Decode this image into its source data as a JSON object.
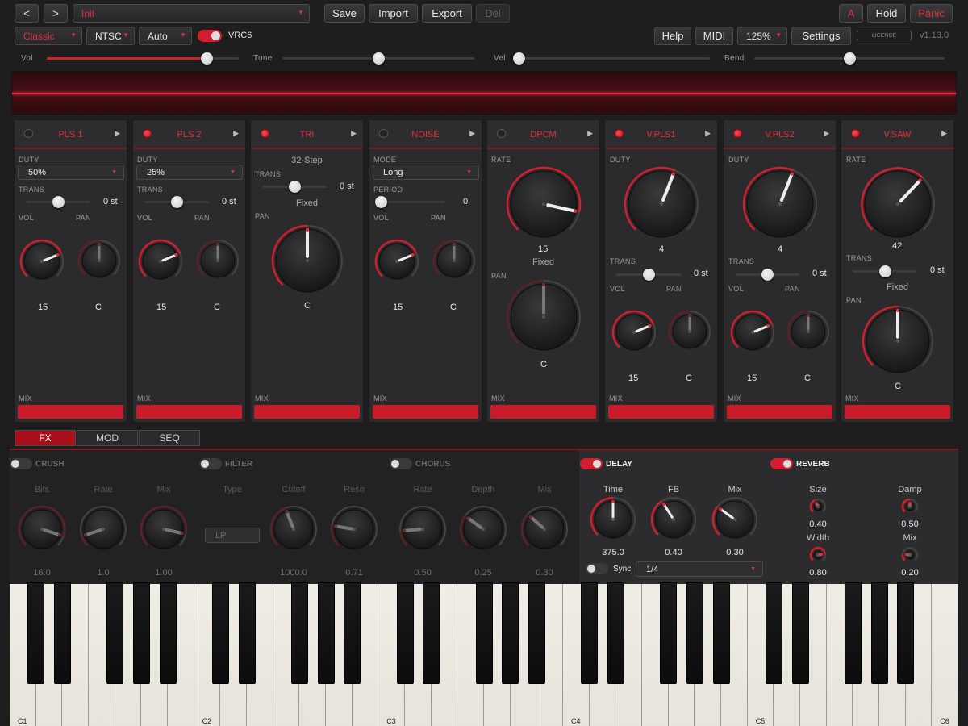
{
  "topbar": {
    "prev_label": "<",
    "next_label": ">",
    "preset_name": "Init",
    "save_label": "Save",
    "import_label": "Import",
    "export_label": "Export",
    "del_label": "Del",
    "a_label": "A",
    "hold_label": "Hold",
    "panic_label": "Panic"
  },
  "secondbar": {
    "mode_value": "Classic",
    "region_value": "NTSC",
    "auto_value": "Auto",
    "vrc6_label": "VRC6",
    "help_label": "Help",
    "midi_label": "MIDI",
    "zoom_value": "125%",
    "settings_label": "Settings",
    "licence_label": "LICENCE",
    "version": "v1.13.0"
  },
  "sliders": {
    "vol_label": "Vol",
    "vol_value": 0.83,
    "tune_label": "Tune",
    "tune_value": 0.5,
    "vel_label": "Vel",
    "vel_value": 0.0,
    "bend_label": "Bend",
    "bend_value": 0.5
  },
  "channels": [
    {
      "name": "PLS 1",
      "led": false,
      "duty_label": "DUTY",
      "duty": "50%",
      "trans_label": "TRANS",
      "trans": "0 st",
      "vol_label": "VOL",
      "pan_label": "PAN",
      "vol": "15",
      "pan": "C",
      "mix_label": "MIX"
    },
    {
      "name": "PLS 2",
      "led": true,
      "duty_label": "DUTY",
      "duty": "25%",
      "trans_label": "TRANS",
      "trans": "0 st",
      "vol_label": "VOL",
      "pan_label": "PAN",
      "vol": "15",
      "pan": "C",
      "mix_label": "MIX"
    },
    {
      "name": "TRI",
      "led": true,
      "step": "32-Step",
      "trans_label": "TRANS",
      "trans": "0 st",
      "fixed": "Fixed",
      "pan_label": "PAN",
      "pan": "C",
      "mix_label": "MIX"
    },
    {
      "name": "NOISE",
      "led": false,
      "mode_label": "MODE",
      "mode": "Long",
      "period_label": "PERIOD",
      "period": "0",
      "vol_label": "VOL",
      "pan_label": "PAN",
      "vol": "15",
      "pan": "C",
      "mix_label": "MIX"
    },
    {
      "name": "DPCM",
      "led": false,
      "rate_label": "RATE",
      "rate": "15",
      "fixed": "Fixed",
      "pan_label": "PAN",
      "pan": "C",
      "mix_label": "MIX"
    },
    {
      "name": "V.PLS1",
      "led": true,
      "duty_label": "DUTY",
      "duty": "4",
      "trans_label": "TRANS",
      "trans": "0 st",
      "vol_label": "VOL",
      "pan_label": "PAN",
      "vol": "15",
      "pan": "C",
      "mix_label": "MIX"
    },
    {
      "name": "V.PLS2",
      "led": true,
      "duty_label": "DUTY",
      "duty": "4",
      "trans_label": "TRANS",
      "trans": "0 st",
      "vol_label": "VOL",
      "pan_label": "PAN",
      "vol": "15",
      "pan": "C",
      "mix_label": "MIX"
    },
    {
      "name": "V.SAW",
      "led": true,
      "rate_label": "RATE",
      "rate": "42",
      "trans_label": "TRANS",
      "trans": "0 st",
      "fixed": "Fixed",
      "pan_label": "PAN",
      "pan": "C",
      "mix_label": "MIX"
    }
  ],
  "tabs": [
    "FX",
    "MOD",
    "SEQ"
  ],
  "fx": {
    "crush": {
      "label": "CRUSH",
      "on": false,
      "bits_label": "Bits",
      "bits": "16.0",
      "rate_label": "Rate",
      "rate": "1.0",
      "mix_label": "Mix",
      "mix": "1.00"
    },
    "filter": {
      "label": "FILTER",
      "on": false,
      "type_label": "Type",
      "type": "LP",
      "cutoff_label": "Cutoff",
      "cutoff": "1000.0",
      "reso_label": "Reso",
      "reso": "0.71"
    },
    "chorus": {
      "label": "CHORUS",
      "on": false,
      "rate_label": "Rate",
      "rate": "0.50",
      "depth_label": "Depth",
      "depth": "0.25",
      "mix_label": "Mix",
      "mix": "0.30"
    },
    "delay": {
      "label": "DELAY",
      "on": true,
      "time_label": "Time",
      "time": "375.0",
      "fb_label": "FB",
      "fb": "0.40",
      "mix_label": "Mix",
      "mix": "0.30",
      "sync_label": "Sync",
      "sync_value": "1/4"
    },
    "reverb": {
      "label": "REVERB",
      "on": true,
      "size_label": "Size",
      "size": "0.40",
      "damp_label": "Damp",
      "damp": "0.50",
      "width_label": "Width",
      "width": "0.80",
      "mix_label": "Mix",
      "mix": "0.20"
    }
  },
  "keyboard": {
    "octaves": [
      "C1",
      "C2",
      "C3",
      "C4",
      "C5",
      "C6"
    ]
  },
  "colors": {
    "accent": "#d21e2e",
    "panel": "#2b2b2d",
    "bg": "#1e1e1f"
  }
}
